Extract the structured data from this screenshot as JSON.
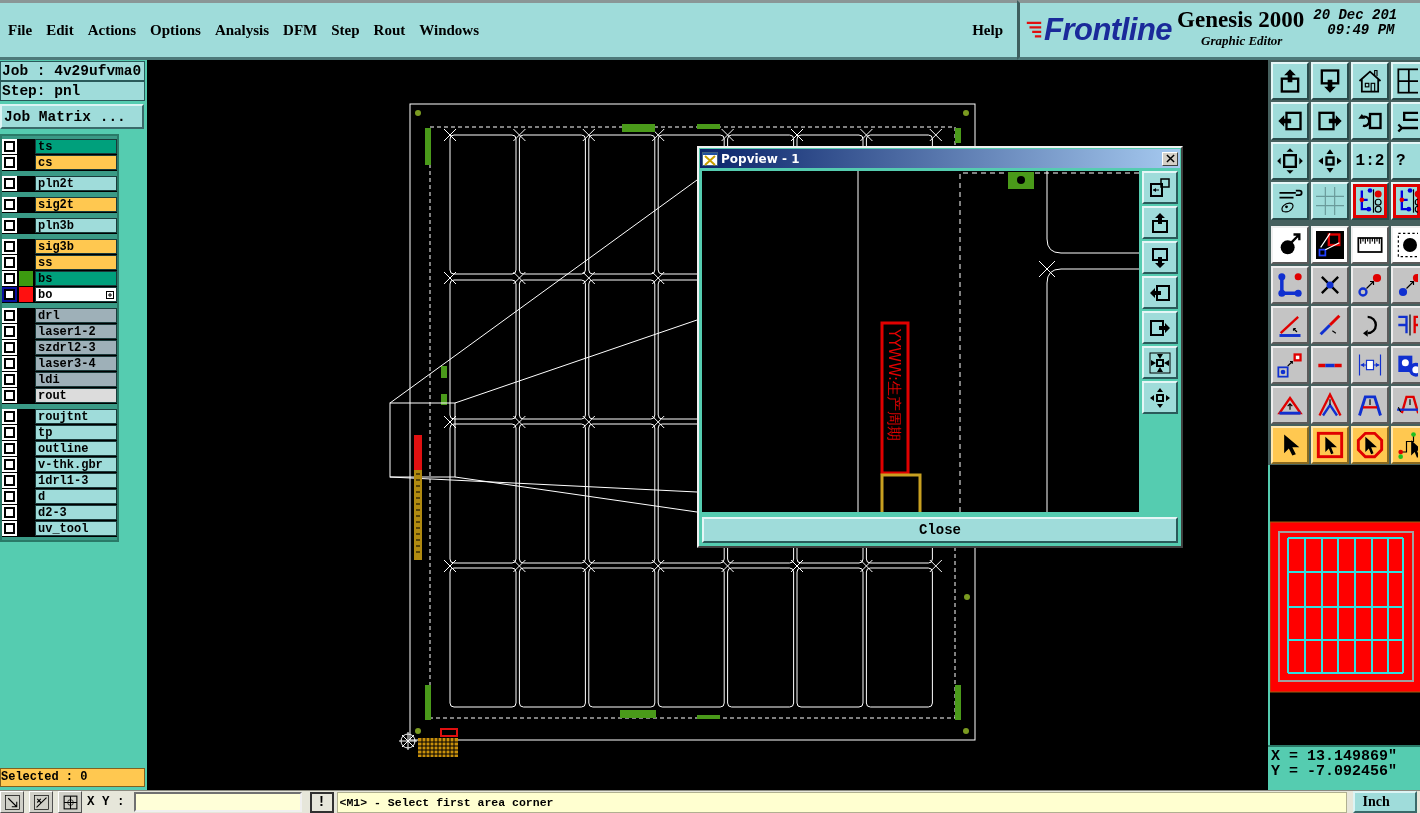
{
  "menu_bar": {
    "items": [
      "File",
      "Edit",
      "Actions",
      "Options",
      "Analysis",
      "DFM",
      "Step",
      "Rout",
      "Windows"
    ],
    "help": "Help"
  },
  "header": {
    "logo": "Frontline",
    "product": "Genesis 2000",
    "subtitle": "Graphic Editor",
    "date": "20 Dec 201",
    "time": "09:49 PM"
  },
  "job": {
    "job": "Job : 4v29ufvma0",
    "step": "Step: pnl",
    "matrix_button": "Job Matrix ..."
  },
  "layer_groups": [
    {
      "layers": [
        {
          "name": "ts",
          "color": "#00a07c",
          "checked": false,
          "selected": false
        },
        {
          "name": "cs",
          "color": "#ffc850",
          "checked": false,
          "selected": false
        }
      ]
    },
    {
      "layers": [
        {
          "name": "pln2t",
          "color": "#9fdcda",
          "checked": false,
          "selected": false
        }
      ]
    },
    {
      "layers": [
        {
          "name": "sig2t",
          "color": "#ffc850",
          "checked": false,
          "selected": false
        }
      ]
    },
    {
      "layers": [
        {
          "name": "pln3b",
          "color": "#9fdcda",
          "checked": false,
          "selected": false
        }
      ]
    },
    {
      "layers": [
        {
          "name": "sig3b",
          "color": "#ffc850",
          "checked": false,
          "selected": false
        },
        {
          "name": "ss",
          "color": "#ffc850",
          "checked": false,
          "selected": false
        },
        {
          "name": "bs",
          "color": "#00a07c",
          "swatch": {
            "color": "#3c9a10"
          },
          "checked": false,
          "selected": false
        },
        {
          "name": "bo",
          "swatch": {
            "color": "#ff1010"
          },
          "checked": false,
          "selected": true
        }
      ]
    },
    {
      "layers": [
        {
          "name": "drl",
          "color": "#9eb0b8",
          "checked": false,
          "selected": false
        },
        {
          "name": "laser1-2",
          "color": "#9eb0b8",
          "checked": false,
          "selected": false
        },
        {
          "name": "szdrl2-3",
          "color": "#9eb0b8",
          "checked": false,
          "selected": false
        },
        {
          "name": "laser3-4",
          "color": "#9eb0b8",
          "checked": false,
          "selected": false
        },
        {
          "name": "ldi",
          "color": "#9eb0b8",
          "checked": false,
          "selected": false
        },
        {
          "name": "rout",
          "color": "#dcdcdc",
          "checked": false,
          "selected": false
        }
      ]
    },
    {
      "layers": [
        {
          "name": "roujtnt",
          "color": "#9fdcda",
          "checked": false,
          "selected": false
        },
        {
          "name": "tp",
          "color": "#9fdcda",
          "checked": false,
          "selected": false
        },
        {
          "name": "outline",
          "color": "#9fdcda",
          "checked": false,
          "selected": false
        },
        {
          "name": "v-thk.gbr",
          "color": "#9fdcda",
          "checked": false,
          "selected": false
        },
        {
          "name": "1drl1-3",
          "color": "#9fdcda",
          "checked": false,
          "selected": false
        },
        {
          "name": "d",
          "color": "#9fdcda",
          "checked": false,
          "selected": false
        },
        {
          "name": "d2-3",
          "color": "#9fdcda",
          "checked": false,
          "selected": false
        },
        {
          "name": "uv_tool",
          "color": "#9fdcda",
          "checked": false,
          "selected": false
        }
      ]
    }
  ],
  "selected_count": "Selected : 0",
  "popview": {
    "title": "Popview - 1",
    "marking_text": "YYWW:生产周期",
    "close_button": "Close"
  },
  "tool_buttons": [
    {
      "active": false
    },
    {
      "active": false
    },
    {
      "active": false
    },
    {
      "active": false
    },
    {
      "active": false
    },
    {
      "active": false
    },
    {
      "active": false
    },
    {
      "active": false
    },
    {
      "active": false
    },
    {
      "active": false
    },
    {
      "label": "1:2",
      "active": false
    },
    {
      "label": "?",
      "active": false
    },
    {
      "active": false
    },
    {
      "active": false
    },
    {
      "active": true
    },
    {
      "active": true
    },
    {
      "active": false
    },
    {
      "active": false
    },
    {
      "active": false
    },
    {
      "active": false
    },
    {
      "active": false
    },
    {
      "active": false
    },
    {
      "active": false
    },
    {
      "active": false
    },
    {
      "active": false
    },
    {
      "active": false
    },
    {
      "active": false
    },
    {
      "active": false
    },
    {
      "active": false
    },
    {
      "active": false
    },
    {
      "active": false
    },
    {
      "active": false
    },
    {
      "active": false
    },
    {
      "active": false
    },
    {
      "active": false
    },
    {
      "active": false
    },
    {
      "active": false
    },
    {
      "active": false
    },
    {
      "active": false
    },
    {
      "active": false
    }
  ],
  "coordinates": {
    "x": "X = 13.149869\"",
    "y": "Y = -7.092456\""
  },
  "status_bar": {
    "xy_label": "X Y :",
    "exec_button": "!",
    "message": "<M1> - Select first area corner",
    "units": "Inch"
  }
}
